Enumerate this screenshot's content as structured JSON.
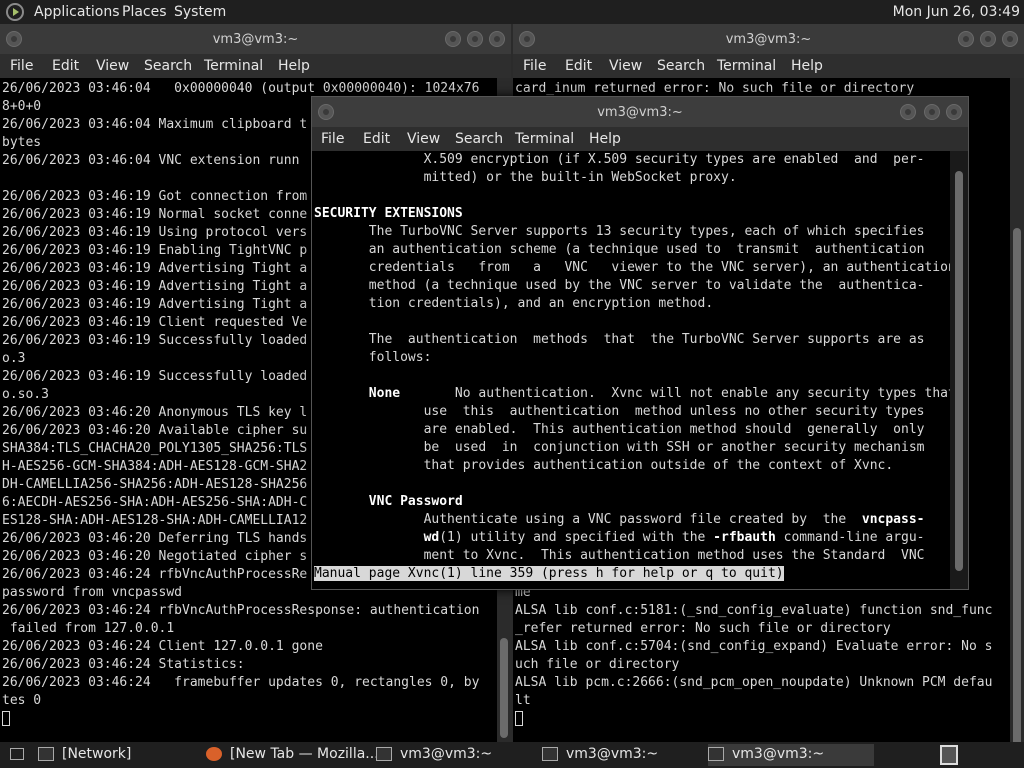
{
  "top_panel": {
    "menus": [
      "Applications",
      "Places",
      "System"
    ],
    "clock": "Mon Jun 26, 03:49"
  },
  "left_window": {
    "title": "vm3@vm3:~",
    "menu": [
      "File",
      "Edit",
      "View",
      "Search",
      "Terminal",
      "Help"
    ],
    "lines": [
      "26/06/2023 03:46:04   0x00000040 (output 0x00000040): 1024x76",
      "8+0+0",
      "26/06/2023 03:46:04 Maximum clipboard t",
      "bytes",
      "26/06/2023 03:46:04 VNC extension runn",
      "",
      "26/06/2023 03:46:19 Got connection from",
      "26/06/2023 03:46:19 Normal socket conne",
      "26/06/2023 03:46:19 Using protocol vers",
      "26/06/2023 03:46:19 Enabling TightVNC p",
      "26/06/2023 03:46:19 Advertising Tight a",
      "26/06/2023 03:46:19 Advertising Tight a",
      "26/06/2023 03:46:19 Advertising Tight a",
      "26/06/2023 03:46:19 Client requested Ve",
      "26/06/2023 03:46:19 Successfully loaded",
      "o.3",
      "26/06/2023 03:46:19 Successfully loaded",
      "o.so.3",
      "26/06/2023 03:46:20 Anonymous TLS key l",
      "26/06/2023 03:46:20 Available cipher su",
      "SHA384:TLS_CHACHA20_POLY1305_SHA256:TLS",
      "H-AES256-GCM-SHA384:ADH-AES128-GCM-SHA2",
      "DH-CAMELLIA256-SHA256:ADH-AES128-SHA256",
      "6:AECDH-AES256-SHA:ADH-AES256-SHA:ADH-C",
      "ES128-SHA:ADH-AES128-SHA:ADH-CAMELLIA12",
      "26/06/2023 03:46:20 Deferring TLS hands",
      "26/06/2023 03:46:20 Negotiated cipher s",
      "26/06/2023 03:46:24 rfbVncAuthProcessRe",
      "password from vncpasswd",
      "26/06/2023 03:46:24 rfbVncAuthProcessResponse: authentication",
      " failed from 127.0.0.1",
      "26/06/2023 03:46:24 Client 127.0.0.1 gone",
      "26/06/2023 03:46:24 Statistics:",
      "26/06/2023 03:46:24   framebuffer updates 0, rectangles 0, by",
      "tes 0"
    ]
  },
  "right_window": {
    "title": "vm3@vm3:~",
    "menu": [
      "File",
      "Edit",
      "View",
      "Search",
      "Terminal",
      "Help"
    ],
    "lines": [
      "card_inum returned error: No such file or directory",
      "                                                    g st",
      "",
      "                                                    func",
      "",
      "                                                    g na",
      "",
      "                                                    func",
      "",
      "                                                    : No s",
      "",
      "                                                    efau",
      "",
      "",
      "                                                    de 51",
      "",
      "                                                    tcode",
      "",
      "                                                    e.Ses",
      "",
      "",
      "                                                    func",
      "",
      "                                                    g st",
      "",
      "                                                    func",
      "",
      "                                                    g na",
      "me",
      "ALSA lib conf.c:5181:(_snd_config_evaluate) function snd_func",
      "_refer returned error: No such file or directory",
      "ALSA lib conf.c:5704:(snd_config_expand) Evaluate error: No s",
      "uch file or directory",
      "ALSA lib pcm.c:2666:(snd_pcm_open_noupdate) Unknown PCM defau",
      "lt"
    ]
  },
  "man_window": {
    "title": "vm3@vm3:~",
    "menu": [
      "File",
      "Edit",
      "View",
      "Search",
      "Terminal",
      "Help"
    ],
    "lines": [
      [
        {
          "t": "              X.509 encryption (if X.509 security types are enabled  and  per-"
        }
      ],
      [
        {
          "t": "              mitted) or the built-in WebSocket proxy."
        }
      ],
      [
        {
          "t": ""
        }
      ],
      [
        {
          "t": "SECURITY EXTENSIONS",
          "b": true
        }
      ],
      [
        {
          "t": "       The TurboVNC Server supports 13 security types, each of which specifies"
        }
      ],
      [
        {
          "t": "       an authentication scheme (a technique used to  transmit  authentication"
        }
      ],
      [
        {
          "t": "       credentials   from   a   VNC   viewer to the VNC server), an authentication"
        }
      ],
      [
        {
          "t": "       method (a technique used by the VNC server to validate the  authentica-"
        }
      ],
      [
        {
          "t": "       tion credentials), and an encryption method."
        }
      ],
      [
        {
          "t": ""
        }
      ],
      [
        {
          "t": "       The  authentication  methods  that  the TurboVNC Server supports are as"
        }
      ],
      [
        {
          "t": "       follows:"
        }
      ],
      [
        {
          "t": ""
        }
      ],
      [
        {
          "t": "       "
        },
        {
          "t": "None",
          "b": true
        },
        {
          "t": "       No authentication.  Xvnc will not enable any security types that"
        }
      ],
      [
        {
          "t": "              use  this  authentication  method unless no other security types"
        }
      ],
      [
        {
          "t": "              are enabled.  This authentication method should  generally  only"
        }
      ],
      [
        {
          "t": "              be  used  in  conjunction with SSH or another security mechanism"
        }
      ],
      [
        {
          "t": "              that provides authentication outside of the context of Xvnc."
        }
      ],
      [
        {
          "t": ""
        }
      ],
      [
        {
          "t": "       "
        },
        {
          "t": "VNC Password",
          "b": true
        }
      ],
      [
        {
          "t": "              Authenticate using a VNC password file created by  the  "
        },
        {
          "t": "vncpass-",
          "b": true
        }
      ],
      [
        {
          "t": "              "
        },
        {
          "t": "wd",
          "b": true
        },
        {
          "t": "(1) utility and specified with the "
        },
        {
          "t": "-rfbauth",
          "b": true
        },
        {
          "t": " command-line argu-"
        }
      ],
      [
        {
          "t": "              ment to Xvnc.  This authentication method uses the Standard  VNC"
        }
      ]
    ],
    "status": "Manual page Xvnc(1) line 359 (press h for help or q to quit)"
  },
  "taskbar": {
    "items": [
      {
        "label": "[Network]",
        "icon": "terminal-icon"
      },
      {
        "label": "[New Tab — Mozilla...",
        "icon": "firefox-icon"
      },
      {
        "label": "vm3@vm3:~",
        "icon": "terminal-icon"
      },
      {
        "label": "vm3@vm3:~",
        "icon": "terminal-icon"
      },
      {
        "label": "vm3@vm3:~",
        "icon": "terminal-icon"
      }
    ]
  }
}
